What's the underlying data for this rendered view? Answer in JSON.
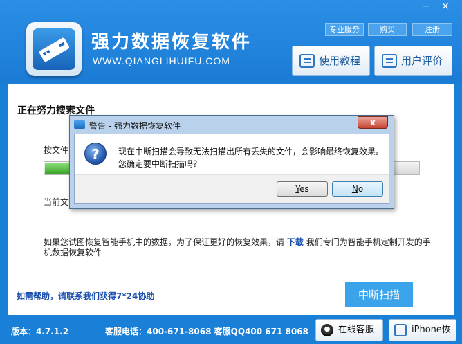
{
  "window": {
    "minimize": "−",
    "close": "×"
  },
  "header": {
    "title": "强力数据恢复软件",
    "url": "WWW.QIANGLIHUIFU.COM",
    "links": [
      "专业服务",
      "购买",
      "注册"
    ],
    "tutorial_label": "使用教程",
    "review_label": "用户评价"
  },
  "main": {
    "heading": "正在努力搜索文件",
    "label_file_prefix": "按文件",
    "label_current_prefix": "当前文",
    "progress": 0.08,
    "note_before": "如果您试图恢复智能手机中的数据，为了保证更好的恢复效果，请",
    "note_link": "下载",
    "note_after": "我们专门为智能手机定制开发的手机数据恢复软件",
    "help_link": "如需帮助，请联系我们获得7*24协助",
    "stop_button": "中断扫描"
  },
  "footer": {
    "version": "版本：4.7.1.2",
    "contact": "客服电话：400-671-8068  客服QQ400 671 8068",
    "online_service": "在线客服",
    "iphone_recovery": "iPhone恢复"
  },
  "dialog": {
    "title": "警告 - 强力数据恢复软件",
    "close": "x",
    "message_line1": "现在中断扫描会导致无法扫描出所有丢失的文件，会影响最终恢复效果。",
    "message_line2": "您确定要中断扫描吗？",
    "question_icon": "question-icon",
    "yes_first": "Y",
    "yes_rest": "es",
    "no_first": "N",
    "no_rest": "o"
  },
  "colors": {
    "brand_blue": "#1a7fd6",
    "button_blue": "#3aa3ea",
    "progress_green": "#3aa52a"
  }
}
